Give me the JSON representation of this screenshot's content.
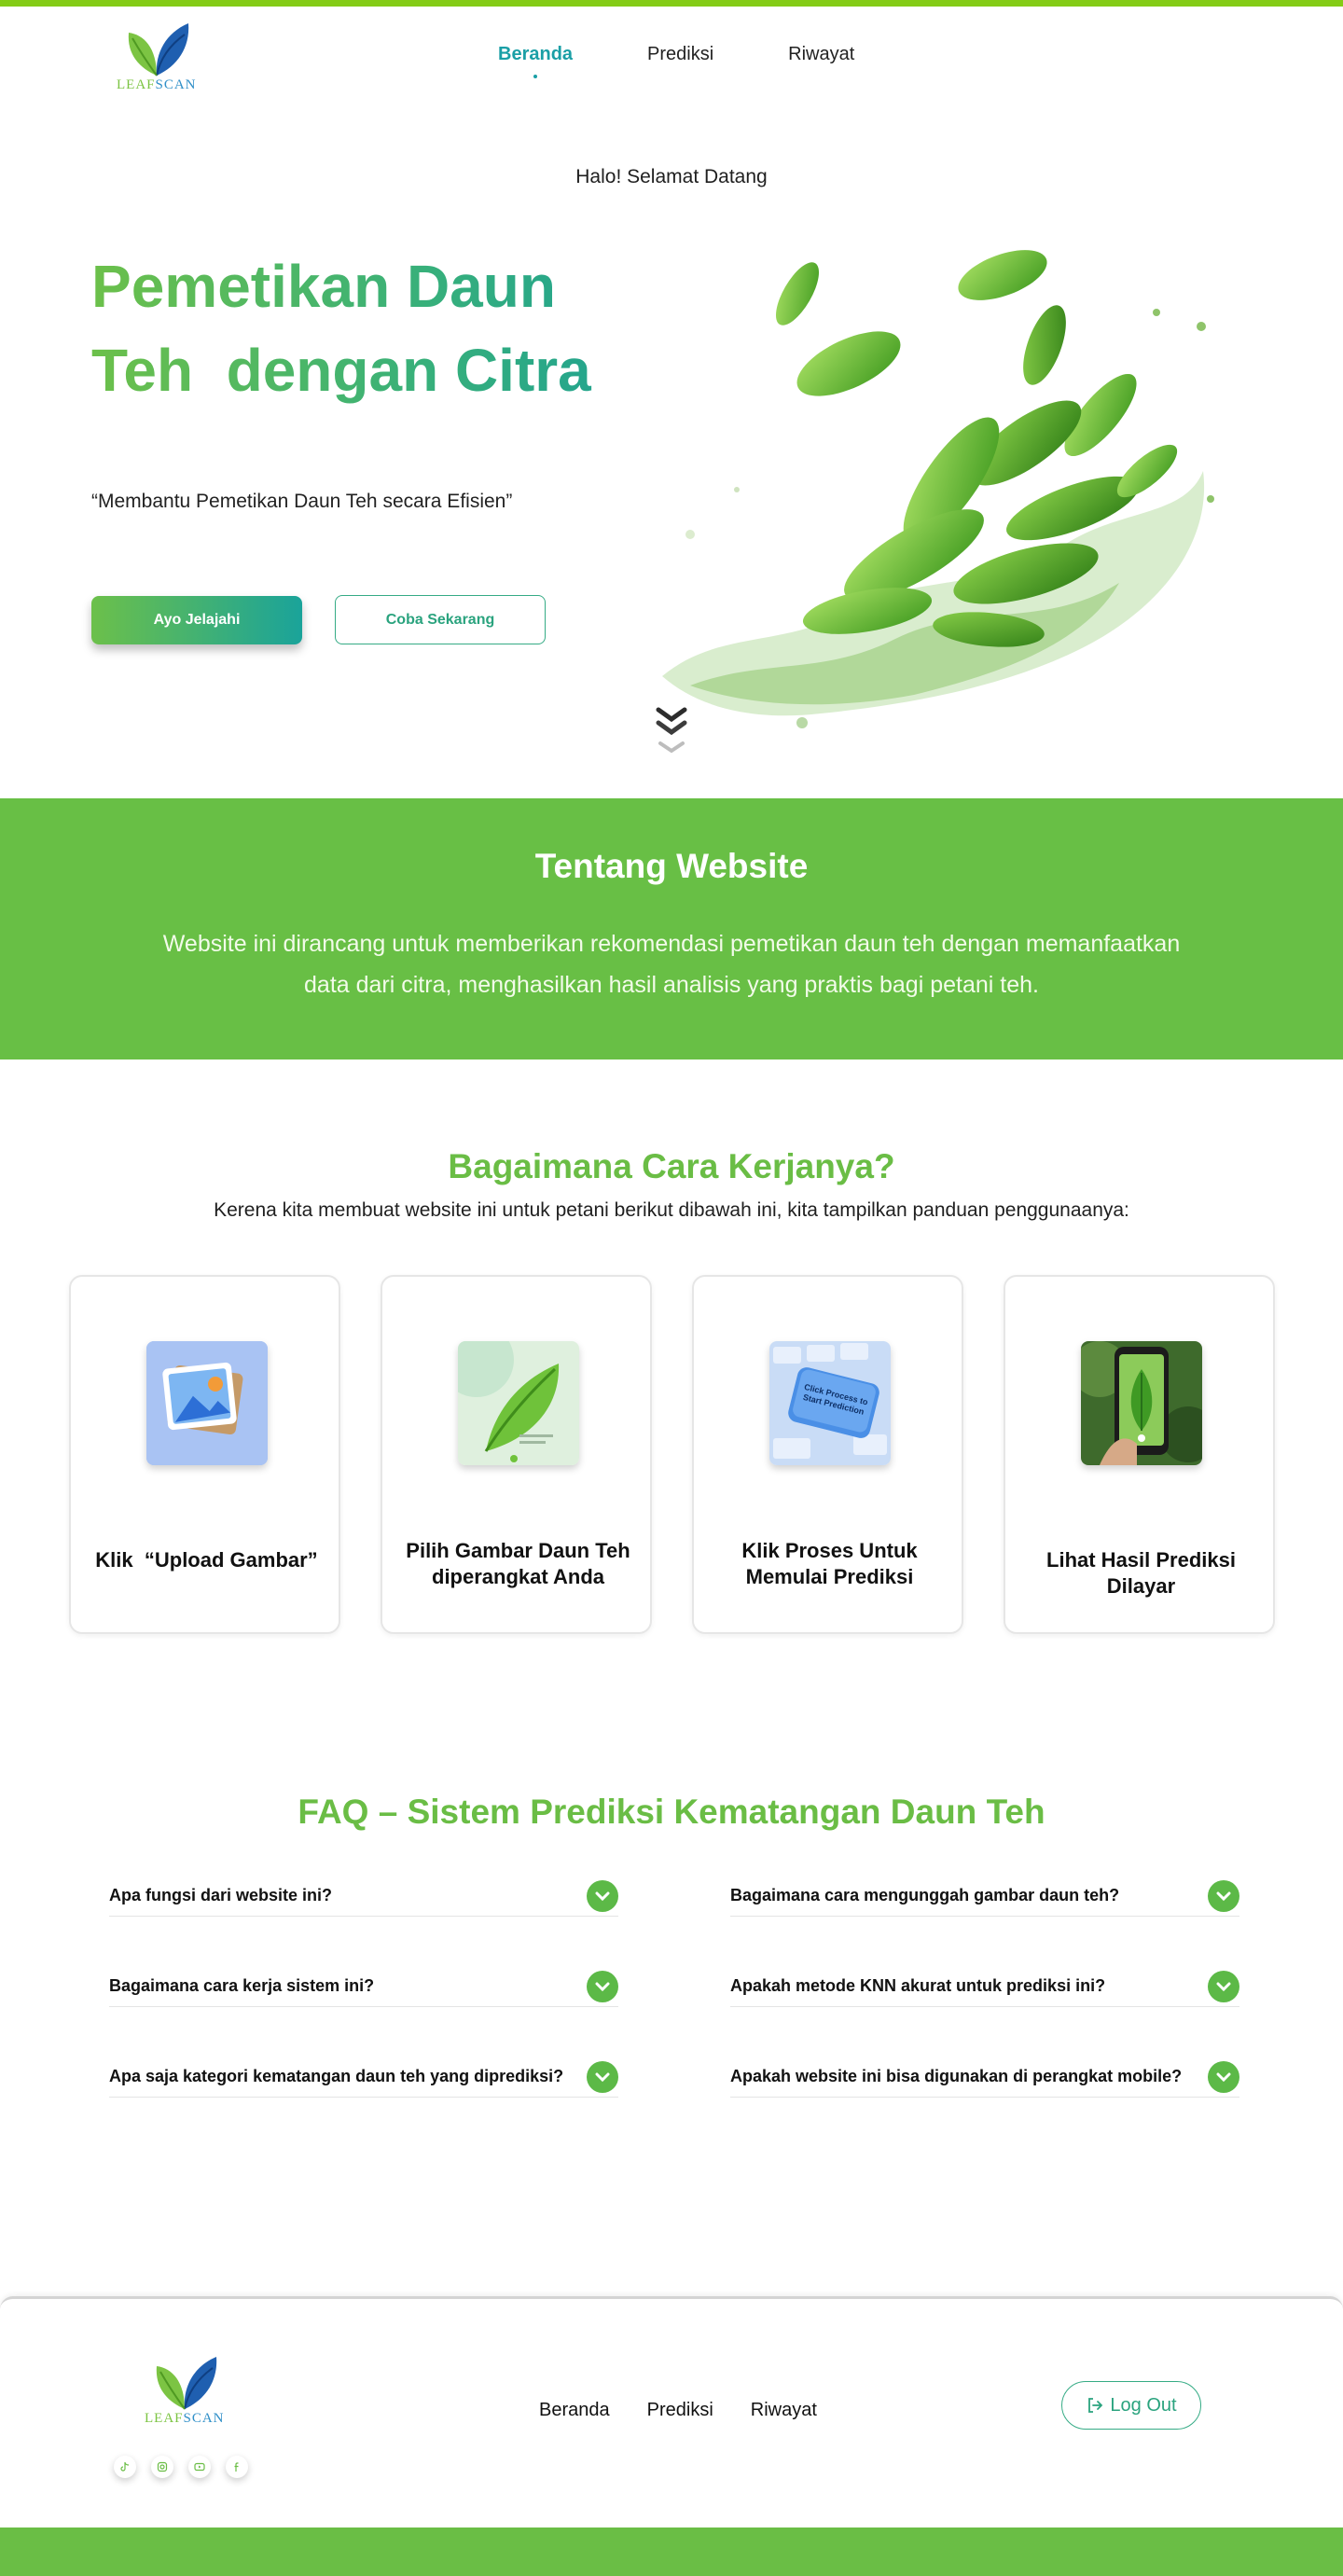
{
  "brand": {
    "logo_part1": "LEAF",
    "logo_part2": "SCAN"
  },
  "nav": {
    "items": [
      "Beranda",
      "Prediksi",
      "Riwayat"
    ],
    "active": "Beranda"
  },
  "hero": {
    "greeting": "Halo! Selamat Datang",
    "title_line1": "Pemetikan Daun",
    "title_line2": "Teh  dengan Citra",
    "quote": "“Membantu Pemetikan Daun Teh secara Efisien”",
    "primary_button": "Ayo Jelajahi",
    "secondary_button": "Coba Sekarang"
  },
  "about": {
    "title": "Tentang Website",
    "text": "Website ini dirancang untuk memberikan rekomendasi pemetikan daun teh dengan memanfaatkan data dari citra, menghasilkan hasil analisis yang praktis bagi petani teh."
  },
  "how": {
    "title": "Bagaimana Cara Kerjanya?",
    "subtitle": "Kerena kita membuat website ini untuk petani berikut dibawah ini, kita tampilkan panduan penggunaanya:",
    "steps": [
      {
        "label": "Klik  “Upload Gambar”",
        "icon": "image-upload-icon"
      },
      {
        "label": "Pilih Gambar Daun Teh diperangkat Anda",
        "icon": "leaf-image-icon"
      },
      {
        "label": "Klik Proses Untuk Memulai Prediksi",
        "icon": "keyboard-key-icon",
        "key_text": "Click Process to Start Prediction"
      },
      {
        "label": "Lihat Hasil Prediksi Dilayar",
        "icon": "phone-photo-icon"
      }
    ]
  },
  "faq": {
    "title": "FAQ – Sistem Prediksi Kematangan Daun Teh",
    "left": [
      "Apa fungsi dari website ini?",
      "Bagaimana cara kerja sistem ini?",
      "Apa saja kategori kematangan daun teh yang diprediksi?"
    ],
    "right": [
      "Bagaimana cara mengunggah gambar daun teh?",
      "Apakah metode KNN akurat untuk prediksi ini?",
      "Apakah website ini bisa digunakan di perangkat mobile?"
    ]
  },
  "footer": {
    "links": [
      "Beranda",
      "Prediksi",
      "Riwayat"
    ],
    "logout": "Log Out",
    "socials": [
      "tiktok-icon",
      "instagram-icon",
      "youtube-icon",
      "facebook-icon"
    ]
  },
  "colors": {
    "primary_green": "#6abd45",
    "teal": "#1a9fa6",
    "accent_border": "#35ab85"
  }
}
